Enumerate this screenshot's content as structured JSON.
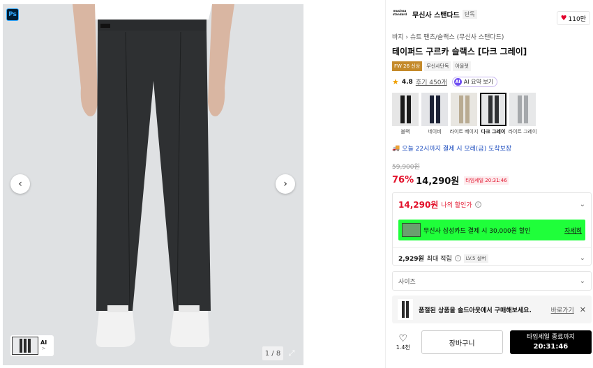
{
  "gallery": {
    "ps_badge": "Ps",
    "prev_icon": "chevron-left-icon",
    "next_icon": "chevron-right-icon",
    "thumb_ai_label": "AI",
    "thumb_ai_sub": ">",
    "counter": "1 / 8",
    "expand_icon": "expand-icon"
  },
  "brand": {
    "logo_text": "musinsa standard",
    "name": "무신사 스탠다드",
    "tag": "단독",
    "like_count": "110만"
  },
  "product": {
    "breadcrumb": "바지 › 슈트 팬츠/슬랙스 (무신사 스탠다드)",
    "title": "테이퍼드 구르카 슬랙스 [다크 그레이]",
    "tags": [
      "FW 26 신상",
      "무신사단독",
      "아울렛"
    ],
    "rating": "4.8",
    "reviews": "후기 450개",
    "ai_label": "AI",
    "ai_summary": "AI 요약 보기"
  },
  "swatches": [
    {
      "label": "블랙",
      "color": "#1a1a1a",
      "bg": "#e6e6e6",
      "selected": false
    },
    {
      "label": "네이비",
      "color": "#1c2236",
      "bg": "#e4e5e8",
      "selected": false
    },
    {
      "label": "라이트 베이지",
      "color": "#b9ab92",
      "bg": "#e8e6e1",
      "selected": false
    },
    {
      "label": "다크 그레이",
      "color": "#2f3133",
      "bg": "#e5e6e7",
      "selected": true
    },
    {
      "label": "라이트 그레이",
      "color": "#a5a8ab",
      "bg": "#e7e8e9",
      "selected": false
    }
  ],
  "delivery": "오늘 22시까지 결제 시 모레(금) 도착보장",
  "price": {
    "original": "59,900원",
    "discount": "76%",
    "sale": "14,290원",
    "timesale": "타임세일 20:31:46"
  },
  "my_price": {
    "value": "14,290원",
    "label": "나의 할인가"
  },
  "card_banner": {
    "text": "무신사 삼성카드 결제 시 30,000원 할인",
    "link": "자세히",
    "color": "#1fff3a"
  },
  "points": {
    "value": "2,929원",
    "label": "최대 적립",
    "level": "LV.5 실버"
  },
  "size_select": {
    "placeholder": "사이즈"
  },
  "soldout": {
    "text": "품절된 상품을 솔드아웃에서 구매해보세요.",
    "link": "바로가기"
  },
  "actions": {
    "wish_count": "1.4천",
    "cart": "장바구니",
    "buy_line1": "타임세일 종료까지",
    "buy_line2": "20:31:46"
  },
  "colors": {
    "accent_red": "#e2102a",
    "buy_bg": "#000000"
  }
}
